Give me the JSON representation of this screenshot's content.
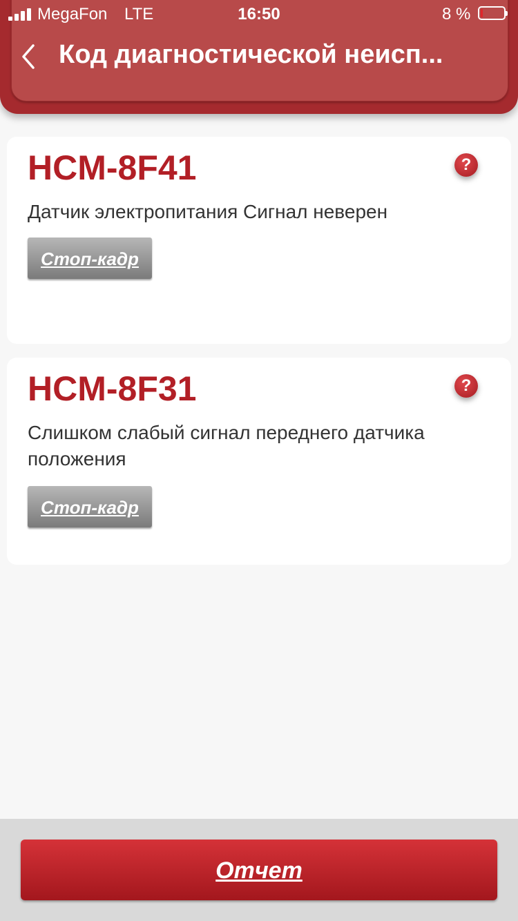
{
  "status_bar": {
    "carrier": "MegaFon",
    "network": "LTE",
    "time": "16:50",
    "battery_percent": "8 %",
    "battery_level": 0.08
  },
  "header": {
    "title": "Код диагностической неисп..."
  },
  "codes": [
    {
      "code": "HCM-8F41",
      "description": "Датчик электропитания Сигнал неверен",
      "freeze_frame_label": "Стоп-кадр",
      "help_glyph": "?"
    },
    {
      "code": "HCM-8F31",
      "description": "Слишком слабый сигнал переднего датчика положения",
      "freeze_frame_label": "Стоп-кадр",
      "help_glyph": "?"
    }
  ],
  "footer": {
    "report_label": "Отчет"
  },
  "colors": {
    "accent_red": "#b21f26",
    "header_red": "#b84a4a",
    "button_gray": "#8a8a8a"
  }
}
